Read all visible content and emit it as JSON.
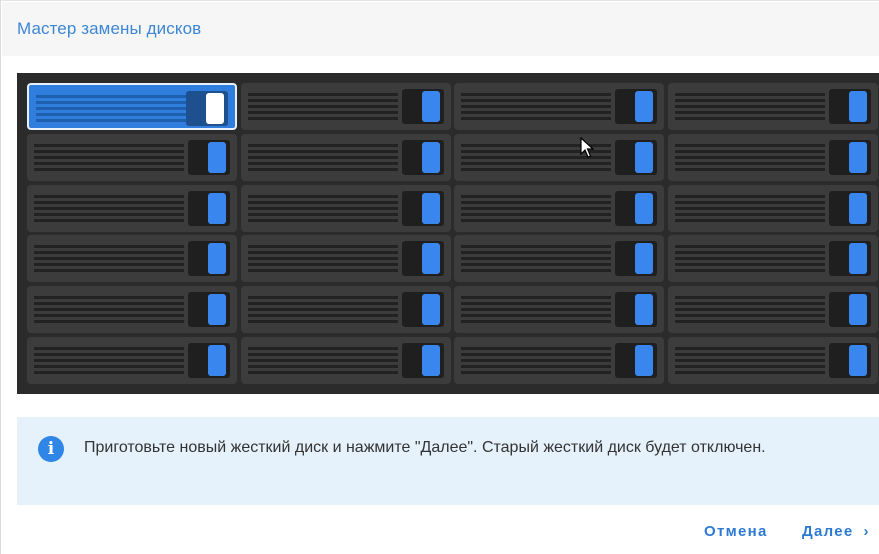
{
  "dialog": {
    "title": "Мастер замены дисков"
  },
  "drive_bays": {
    "rows": 6,
    "columns": 4,
    "selected": "bay-1-1"
  },
  "info": {
    "icon": "info-icon",
    "message": "Приготовьте новый жесткий диск и нажмите \"Далее\". Старый жесткий диск будет отключен."
  },
  "footer": {
    "cancel_label": "Отмена",
    "next_label": "Далее",
    "next_icon": "chevron-right-icon"
  },
  "colors": {
    "accent": "#3d86d6",
    "bay_led": "#3a86ef",
    "info_bg": "#e6f2fb"
  }
}
